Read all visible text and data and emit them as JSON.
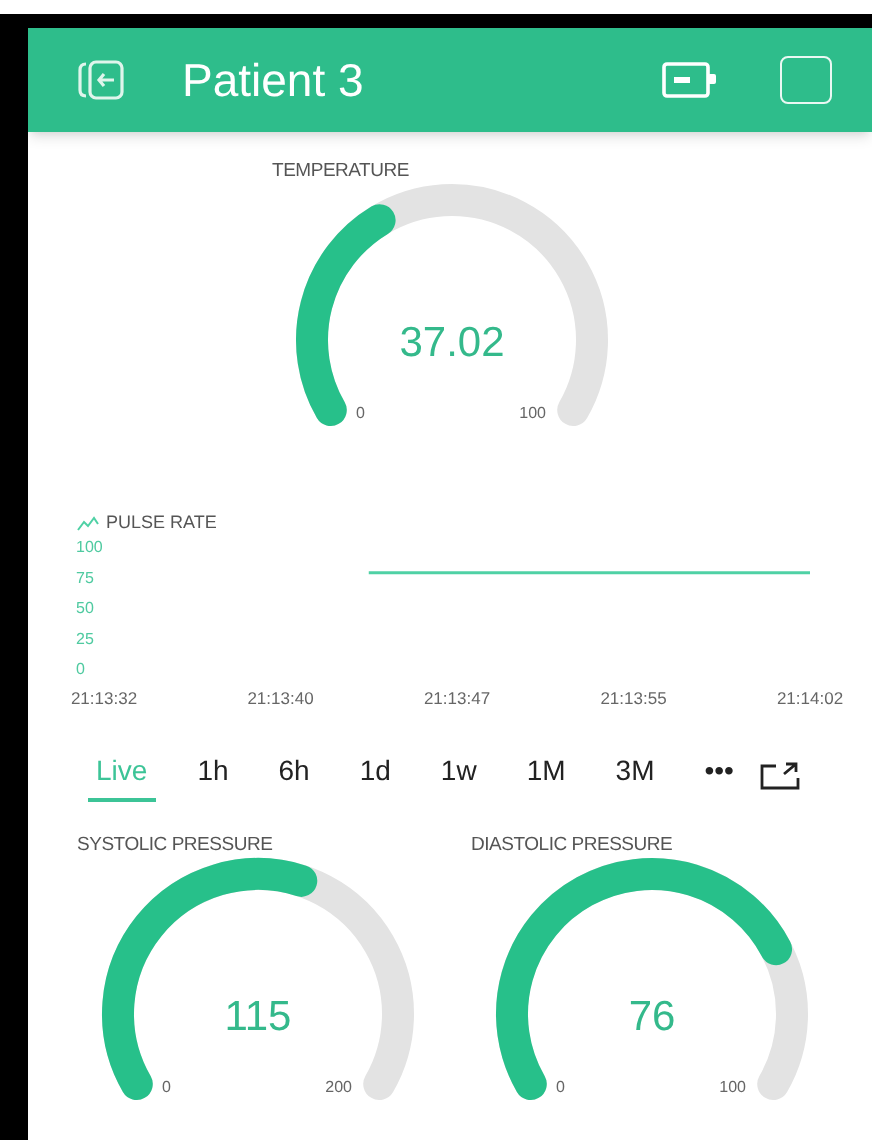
{
  "header": {
    "title": "Patient 3"
  },
  "temperature_gauge": {
    "title": "TEMPERATURE",
    "value": "37.02",
    "min": "0",
    "max": "100"
  },
  "pulse_chart": {
    "title": "PULSE RATE",
    "chart_data": {
      "type": "line",
      "ylim": [
        0,
        100
      ],
      "yticks": [
        0,
        25,
        50,
        75,
        100
      ],
      "categories": [
        "21:13:32",
        null,
        "21:13:40",
        null,
        "21:13:47",
        null,
        "21:13:55",
        null,
        "21:14:02"
      ],
      "series": [
        {
          "color": "#4fd1a5",
          "values": [
            null,
            null,
            null,
            78,
            78,
            78,
            78,
            78,
            78
          ]
        }
      ]
    }
  },
  "period_tabs": [
    {
      "label": "Live",
      "selected": true
    },
    {
      "label": "1h",
      "selected": false
    },
    {
      "label": "6h",
      "selected": false
    },
    {
      "label": "1d",
      "selected": false
    },
    {
      "label": "1w",
      "selected": false
    },
    {
      "label": "1M",
      "selected": false
    },
    {
      "label": "3M",
      "selected": false
    },
    {
      "label": "•••",
      "selected": false
    }
  ],
  "pressure_gauges": [
    {
      "title": "SYSTOLIC PRESSURE",
      "value": "115",
      "min": "0",
      "max": "200"
    },
    {
      "title": "DIASTOLIC PRESSURE",
      "value": "76",
      "min": "0",
      "max": "100"
    }
  ]
}
